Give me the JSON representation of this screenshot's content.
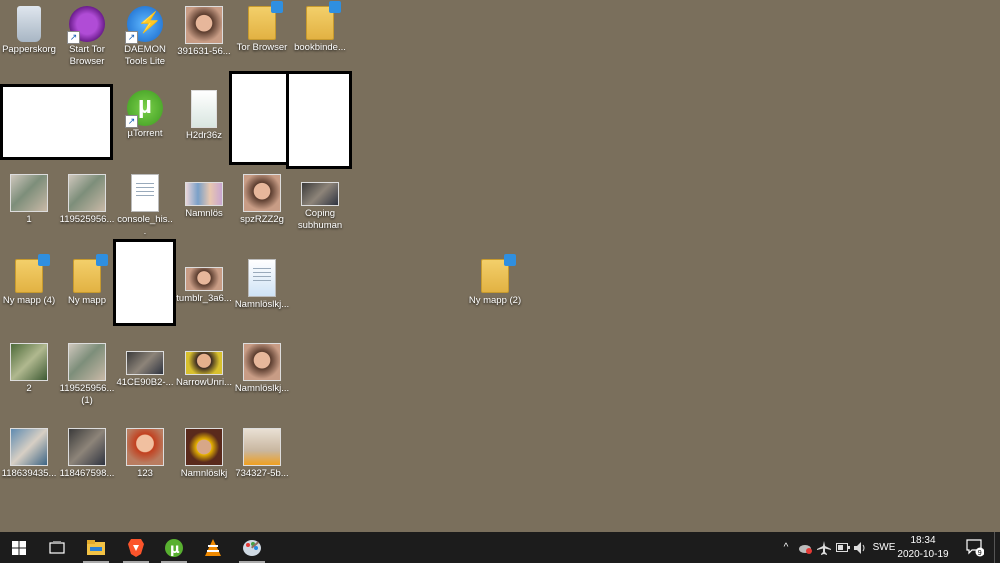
{
  "desktop": {
    "icons": [
      {
        "label": "Papperskorg",
        "kind": "recycle-bin-icon"
      },
      {
        "label": "Start Tor Browser",
        "kind": "tor-browser-icon"
      },
      {
        "label": "DAEMON Tools Lite",
        "kind": "daemon-tools-icon"
      },
      {
        "label": "391631-56...",
        "kind": "image-file-icon"
      },
      {
        "label": "Tor Browser",
        "kind": "folder-icon"
      },
      {
        "label": "bookbinde...",
        "kind": "folder-icon"
      },
      {
        "label": "µTorrent",
        "kind": "utorrent-icon"
      },
      {
        "label": "H2dr36z",
        "kind": "image-file-icon"
      },
      {
        "label": "1",
        "kind": "image-file-icon"
      },
      {
        "label": "119525956...",
        "kind": "image-file-icon"
      },
      {
        "label": "console_his...",
        "kind": "text-file-icon"
      },
      {
        "label": "Namnlös",
        "kind": "image-file-icon"
      },
      {
        "label": "spzRZZ2g",
        "kind": "image-file-icon"
      },
      {
        "label": "Coping subhuman",
        "kind": "video-file-icon"
      },
      {
        "label": "Ny mapp (4)",
        "kind": "folder-icon"
      },
      {
        "label": "Ny mapp",
        "kind": "folder-icon"
      },
      {
        "label": "tumblr_3a6...",
        "kind": "image-file-icon"
      },
      {
        "label": "Namnlöslkj...",
        "kind": "image-file-icon"
      },
      {
        "label": "Ny mapp (2)",
        "kind": "folder-icon"
      },
      {
        "label": "2",
        "kind": "image-file-icon"
      },
      {
        "label": "119525956... (1)",
        "kind": "image-file-icon"
      },
      {
        "label": "41CE90B2-...",
        "kind": "image-file-icon"
      },
      {
        "label": "NarrowUnri...",
        "kind": "image-file-icon"
      },
      {
        "label": "Namnlöslkj...",
        "kind": "image-file-icon"
      },
      {
        "label": "118639435...",
        "kind": "image-file-icon"
      },
      {
        "label": "118467598...",
        "kind": "image-file-icon"
      },
      {
        "label": "123",
        "kind": "image-file-icon"
      },
      {
        "label": "Namnlöslkj",
        "kind": "image-file-icon"
      },
      {
        "label": "734327-5b...",
        "kind": "image-file-icon"
      }
    ]
  },
  "taskbar": {
    "start": "start-icon",
    "task_view": "task-view-icon",
    "pinned": [
      "file-explorer-icon",
      "brave-browser-icon",
      "utorrent-icon",
      "vlc-icon",
      "paint-icon"
    ],
    "tray": {
      "chevron": "^",
      "language": "SWE",
      "time": "18:34",
      "date": "2020-10-19",
      "notifications_count": "9"
    }
  }
}
